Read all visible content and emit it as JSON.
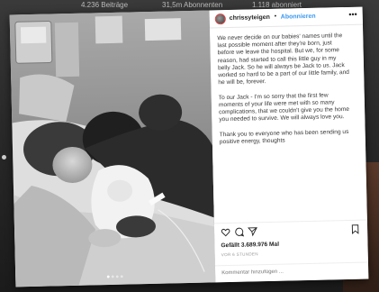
{
  "profile": {
    "stats": [
      "4.236 Beiträge",
      "31,5m Abonnenten",
      "1.118 abonniert"
    ]
  },
  "post": {
    "username": "chrissyteigen",
    "separator": "•",
    "follow_label": "Abonnieren",
    "more_icon": "more-horizontal-icon",
    "caption": [
      "We never decide on our babies' names until the last possible moment after they're born, just before we leave the hospital. But we, for some reason, had started to call this little guy in my belly Jack. So he will always be Jack to us. Jack worked so hard to be a part of our little family, and he will be, forever.",
      "To our Jack - I'm so sorry that the first few moments of your life were met with so many complications, that we couldn't give you the home you needed to survive. We will always love you.",
      "Thank you to everyone who has been sending us positive energy, thoughts"
    ],
    "likes": "Gefällt 3.689.976 Mal",
    "time_ago": "VOR 6 STUNDEN",
    "comment_placeholder": "Kommentar hinzufügen ...",
    "icons": [
      "heart-icon",
      "comment-icon",
      "share-icon",
      "bookmark-icon"
    ]
  }
}
